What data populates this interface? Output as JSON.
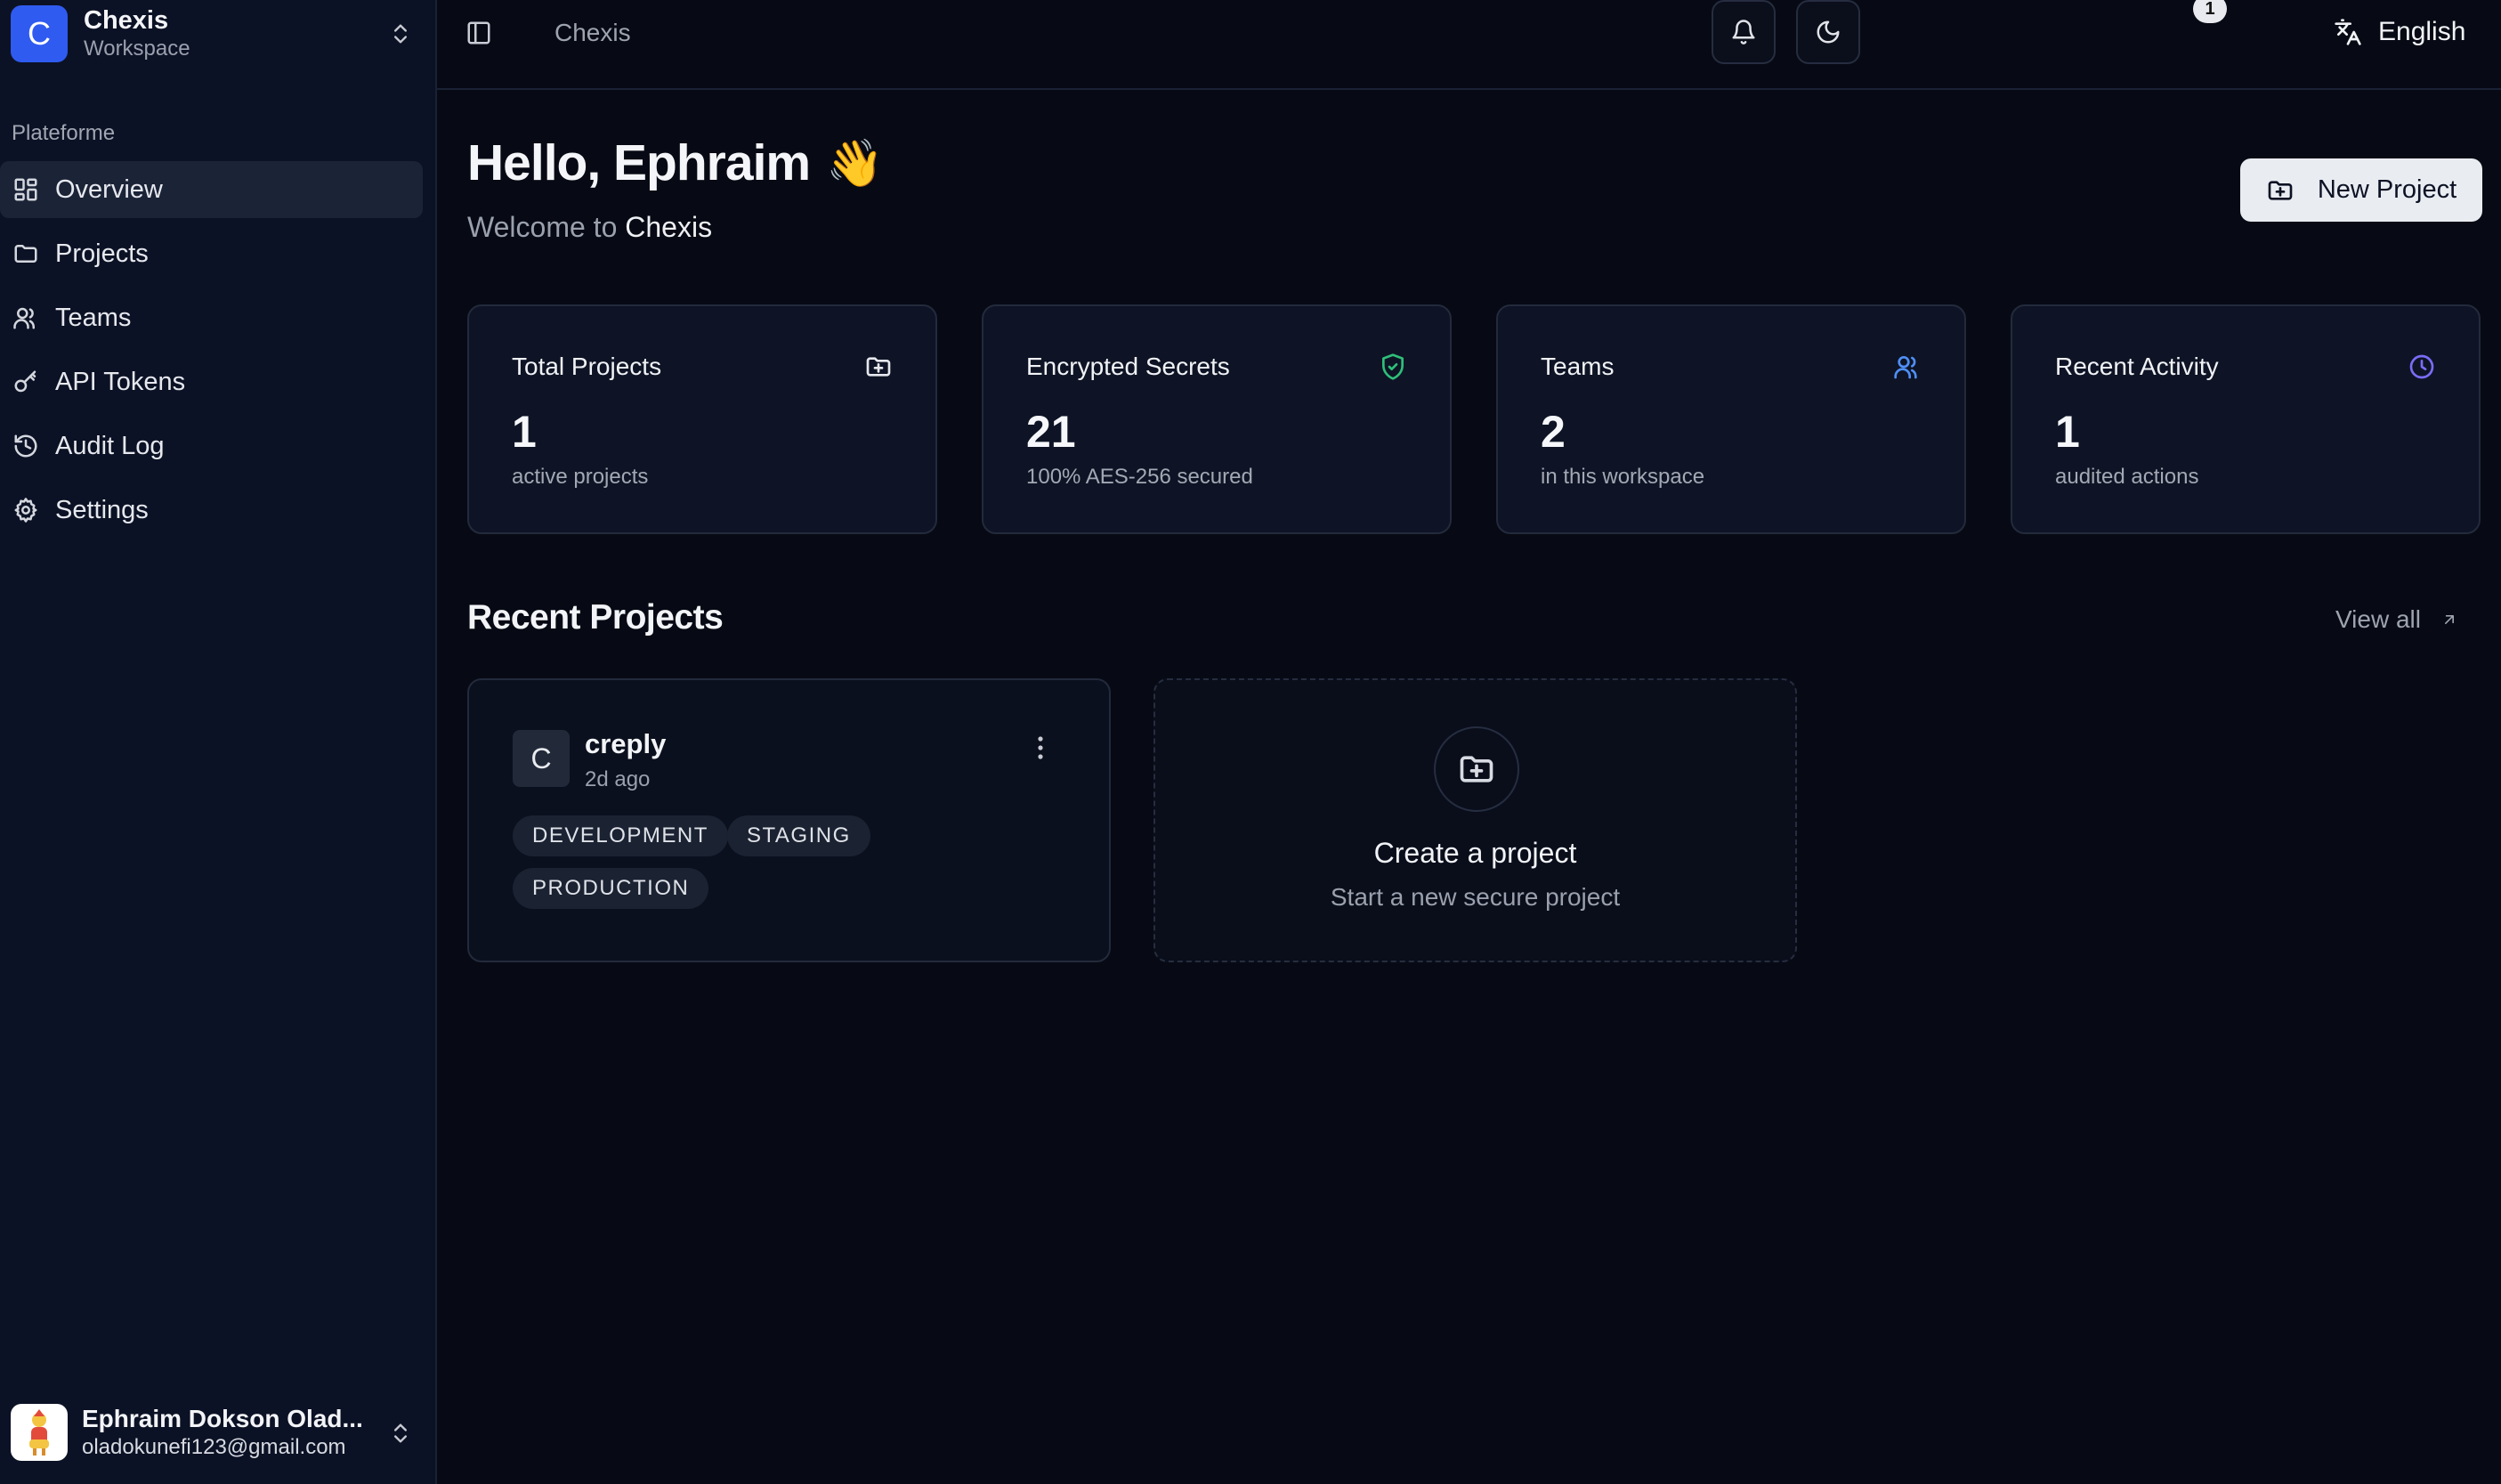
{
  "workspace": {
    "initial": "C",
    "name": "Chexis",
    "subtitle": "Workspace"
  },
  "sidebar": {
    "section_label": "Plateforme",
    "items": [
      {
        "label": "Overview",
        "icon": "layout-dashboard-icon",
        "active": true
      },
      {
        "label": "Projects",
        "icon": "folder-icon"
      },
      {
        "label": "Teams",
        "icon": "users-icon"
      },
      {
        "label": "API Tokens",
        "icon": "key-icon"
      },
      {
        "label": "Audit Log",
        "icon": "history-icon"
      },
      {
        "label": "Settings",
        "icon": "gear-icon"
      }
    ]
  },
  "user": {
    "name": "Ephraim Dokson Olad...",
    "email": "oladokunefi123@gmail.com"
  },
  "header": {
    "breadcrumb": "Chexis",
    "notification_count": "1",
    "language": "English"
  },
  "main": {
    "greeting": "Hello, Ephraim",
    "greeting_emoji": "👋",
    "welcome_prefix": "Welcome to",
    "welcome_brand": "Chexis",
    "new_project_label": "New Project",
    "stats": [
      {
        "label": "Total Projects",
        "value": "1",
        "sub": "active projects",
        "icon": "folder-plus-icon",
        "color": "#e6e8ee"
      },
      {
        "label": "Encrypted Secrets",
        "value": "21",
        "sub": "100% AES-256 secured",
        "icon": "shield-check-icon",
        "color": "#2fbf7a"
      },
      {
        "label": "Teams",
        "value": "2",
        "sub": "in this workspace",
        "icon": "users-icon",
        "color": "#4f8ff7"
      },
      {
        "label": "Recent Activity",
        "value": "1",
        "sub": "audited actions",
        "icon": "clock-icon",
        "color": "#7b6cf6"
      }
    ],
    "recent_title": "Recent Projects",
    "view_all_label": "View all",
    "projects": [
      {
        "initial": "C",
        "name": "creply",
        "time": "2d ago",
        "environments": [
          "DEVELOPMENT",
          "STAGING",
          "PRODUCTION"
        ]
      }
    ],
    "create_card": {
      "title": "Create a project",
      "subtitle": "Start a new secure project"
    }
  }
}
